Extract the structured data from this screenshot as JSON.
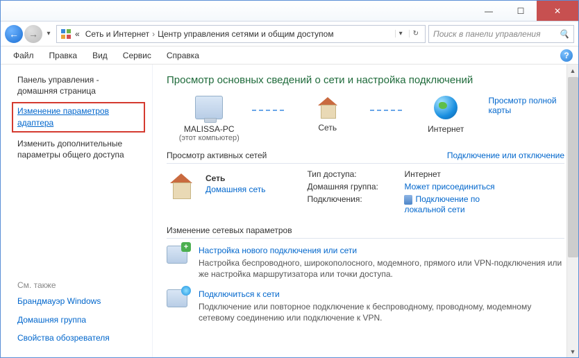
{
  "titlebar": {
    "minimize": "—",
    "maximize": "☐",
    "close": "✕"
  },
  "addressbar": {
    "back_chevrons": "«",
    "crumb1": "Сеть и Интернет",
    "crumb2": "Центр управления сетями и общим доступом",
    "sep": "›",
    "search_placeholder": "Поиск в панели управления"
  },
  "menubar": {
    "file": "Файл",
    "edit": "Правка",
    "view": "Вид",
    "tools": "Сервис",
    "help": "Справка"
  },
  "sidebar": {
    "home1": "Панель управления -",
    "home2": "домашняя страница",
    "adapter1": "Изменение параметров",
    "adapter2": "адаптера",
    "sharing1": "Изменить дополнительные",
    "sharing2": "параметры общего доступа",
    "seealso_h": "См. также",
    "firewall": "Брандмауэр Windows",
    "homegroup": "Домашняя группа",
    "inet": "Свойства обозревателя"
  },
  "main": {
    "title": "Просмотр основных сведений о сети и настройка подключений",
    "full_map": "Просмотр полной карты",
    "node_pc": "MALISSA-PC",
    "node_pc_sub": "(этот компьютер)",
    "node_net": "Сеть",
    "node_inet": "Интернет",
    "active_h": "Просмотр активных сетей",
    "active_link": "Подключение или отключение",
    "net_name": "Сеть",
    "net_type": "Домашняя сеть",
    "props": {
      "access_l": "Тип доступа:",
      "access_v": "Интернет",
      "hg_l": "Домашняя группа:",
      "hg_v": "Может присоединиться",
      "conn_l": "Подключения:",
      "conn_v1": "Подключение по",
      "conn_v2": "локальной сети"
    },
    "change_h": "Изменение сетевых параметров",
    "task1_link": "Настройка нового подключения или сети",
    "task1_desc": "Настройка беспроводного, широкополосного, модемного, прямого или VPN-подключения или же настройка маршрутизатора или точки доступа.",
    "task2_link": "Подключиться к сети",
    "task2_desc": "Подключение или повторное подключение к беспроводному, проводному, модемному сетевому соединению или подключение к VPN."
  }
}
